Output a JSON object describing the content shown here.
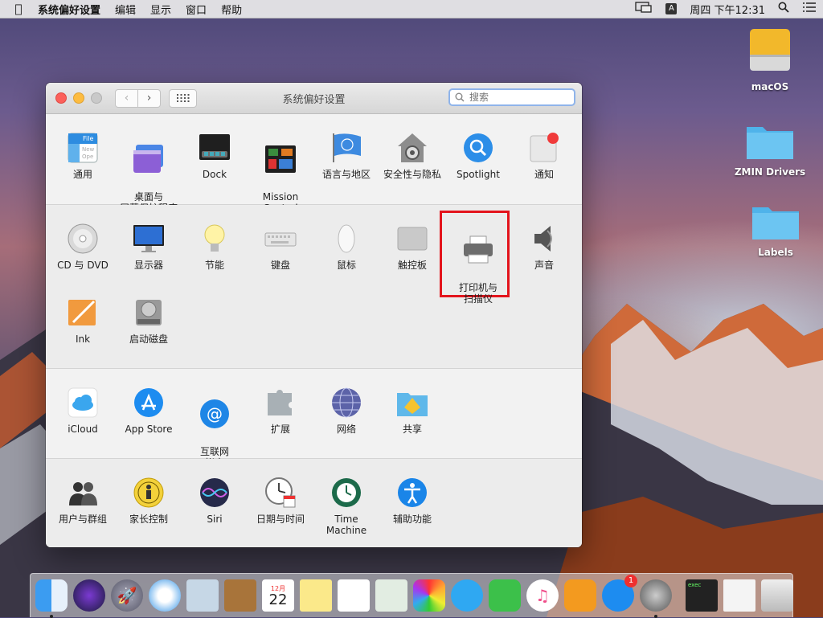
{
  "menubar": {
    "app": "系统偏好设置",
    "items": [
      "编辑",
      "显示",
      "窗口",
      "帮助"
    ],
    "input_badge": "A",
    "clock": "周四 下午12:31"
  },
  "desktop": {
    "icons": [
      "macOS",
      "ZMIN Drivers",
      "Labels"
    ]
  },
  "window": {
    "title": "系统偏好设置",
    "search_placeholder": "搜索"
  },
  "sections": {
    "personal": [
      {
        "label": "通用",
        "icon": "general-icon"
      },
      {
        "label": "桌面与\n屏幕保护程序",
        "icon": "desktop-screensaver-icon"
      },
      {
        "label": "Dock",
        "icon": "dock-icon"
      },
      {
        "label": "Mission\nControl",
        "icon": "mission-control-icon"
      },
      {
        "label": "语言与地区",
        "icon": "language-region-icon"
      },
      {
        "label": "安全性与隐私",
        "icon": "security-privacy-icon"
      },
      {
        "label": "Spotlight",
        "icon": "spotlight-icon"
      },
      {
        "label": "通知",
        "icon": "notifications-icon"
      }
    ],
    "hardware": [
      {
        "label": "CD 与 DVD",
        "icon": "cd-dvd-icon"
      },
      {
        "label": "显示器",
        "icon": "displays-icon"
      },
      {
        "label": "节能",
        "icon": "energy-saver-icon"
      },
      {
        "label": "键盘",
        "icon": "keyboard-icon"
      },
      {
        "label": "鼠标",
        "icon": "mouse-icon"
      },
      {
        "label": "触控板",
        "icon": "trackpad-icon"
      },
      {
        "label": "打印机与\n扫描仪",
        "icon": "printers-scanners-icon"
      },
      {
        "label": "声音",
        "icon": "sound-icon"
      },
      {
        "label": "Ink",
        "icon": "ink-icon"
      },
      {
        "label": "启动磁盘",
        "icon": "startup-disk-icon"
      }
    ],
    "internet": [
      {
        "label": "iCloud",
        "icon": "icloud-icon"
      },
      {
        "label": "App Store",
        "icon": "app-store-icon"
      },
      {
        "label": "互联网\n帐户",
        "icon": "internet-accounts-icon"
      },
      {
        "label": "扩展",
        "icon": "extensions-icon"
      },
      {
        "label": "网络",
        "icon": "network-icon"
      },
      {
        "label": "共享",
        "icon": "sharing-icon"
      }
    ],
    "system": [
      {
        "label": "用户与群组",
        "icon": "users-groups-icon"
      },
      {
        "label": "家长控制",
        "icon": "parental-controls-icon"
      },
      {
        "label": "Siri",
        "icon": "siri-icon"
      },
      {
        "label": "日期与时间",
        "icon": "date-time-icon"
      },
      {
        "label": "Time Machine",
        "icon": "time-machine-icon"
      },
      {
        "label": "辅助功能",
        "icon": "accessibility-icon"
      }
    ]
  },
  "dock": {
    "calendar_month": "12月",
    "calendar_day": "22",
    "app_store_badge": "1",
    "terminal_text": "exec"
  },
  "colors": {
    "highlight": "#e3141c",
    "search_focus": "#8fb4ea"
  }
}
